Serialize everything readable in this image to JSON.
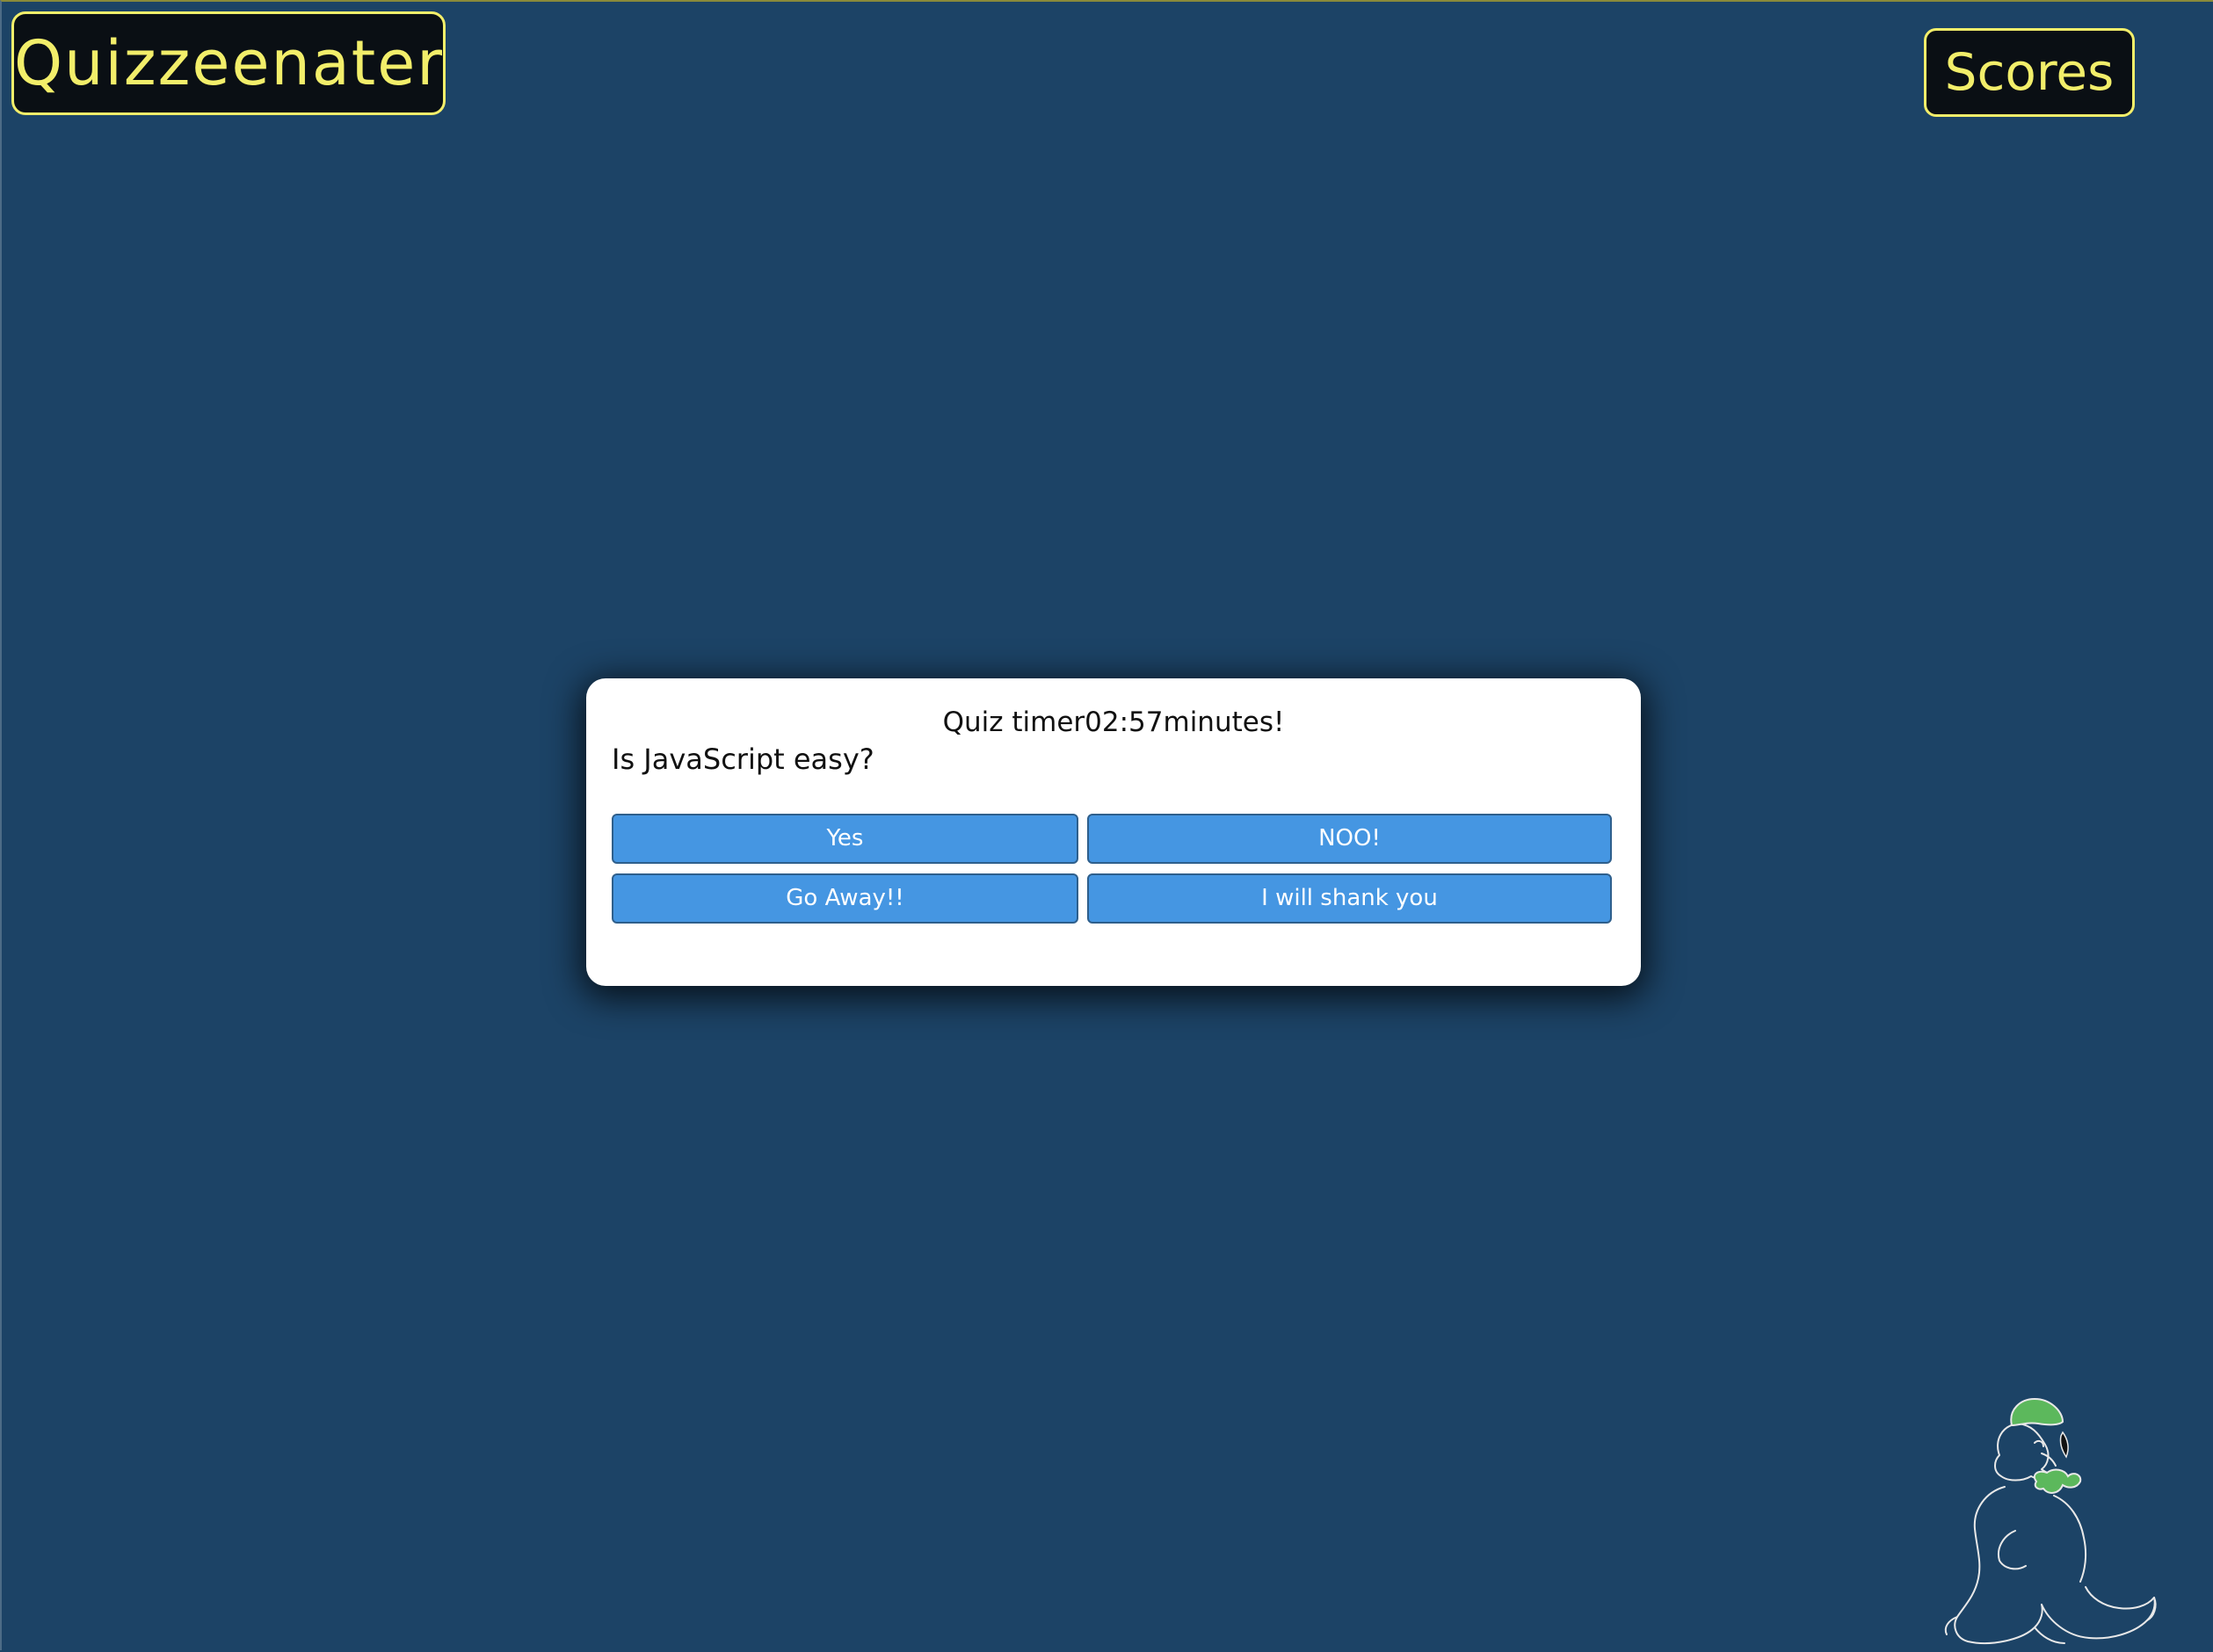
{
  "header": {
    "title": "Quizzeenater",
    "scores_label": "Scores"
  },
  "quiz": {
    "timer_prefix": "Quiz timer",
    "timer_value": "02:57",
    "timer_suffix": "minutes!",
    "question": "Is JavaScript easy?",
    "answers": [
      "Yes",
      "NOO!",
      "Go Away!!",
      "I will shank you"
    ]
  },
  "decor": {
    "mascot_icon": "duck-character-outline-icon"
  },
  "colors": {
    "background": "#1c4366",
    "accent_yellow": "#f2ee6a",
    "header_bg": "#0a0f14",
    "answer_button": "#4596e2",
    "mascot_green": "#5cb85c"
  }
}
